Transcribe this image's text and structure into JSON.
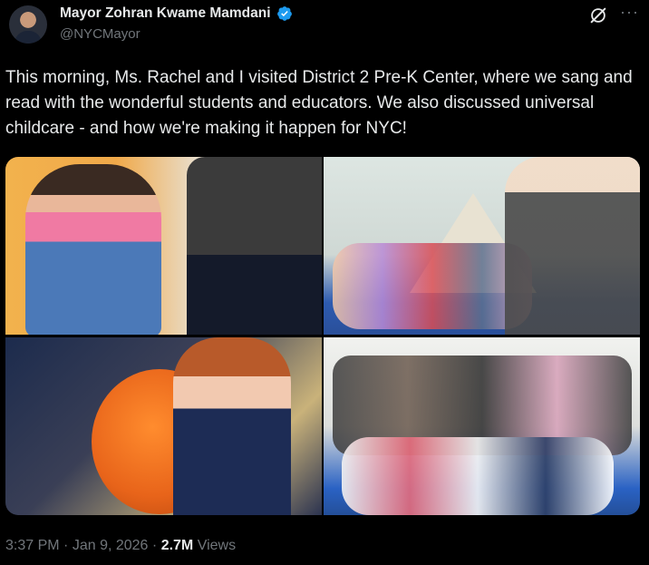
{
  "author": {
    "name": "Mayor Zohran Kwame Mamdani",
    "handle": "@NYCMayor",
    "verified_color": "#1d9bf0"
  },
  "tweet": {
    "text": "This morning, Ms. Rachel and I visited District 2 Pre-K Center, where we sang and read with the wonderful students and educators. We also discussed universal childcare - and how we're making it happen for NYC!"
  },
  "media": {
    "photos": [
      {
        "icon": "photo-woman-man-seated"
      },
      {
        "icon": "photo-children-story-time"
      },
      {
        "icon": "photo-child-hugging-puppet"
      },
      {
        "icon": "photo-group-clapping"
      }
    ]
  },
  "meta": {
    "time": "3:37 PM",
    "separator": "·",
    "date": "Jan 9, 2026",
    "views_count": "2.7M",
    "views_label": "Views"
  },
  "icons": {
    "grok": "grok-icon",
    "more": "more-icon",
    "more_glyph": "···"
  },
  "colors": {
    "background": "#000000",
    "text": "#e7e9ea",
    "muted": "#71767b"
  }
}
